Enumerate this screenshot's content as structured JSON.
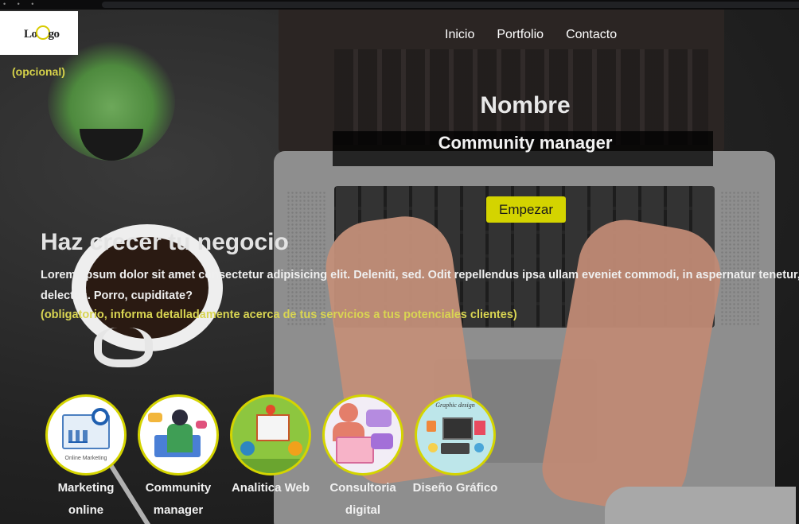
{
  "header": {
    "logo_text": "Lo",
    "logo_text_end": "go",
    "logo_note": "(opcional)",
    "nav": [
      "Inicio",
      "Portfolio",
      "Contacto"
    ]
  },
  "hero": {
    "name": "Nombre",
    "role": "Community manager",
    "cta_label": "Empezar"
  },
  "about": {
    "heading": "Haz crecer tu negocio",
    "body_line1": "Lorem, ipsum dolor sit amet consectetur adipisicing elit. Deleniti, sed. Odit repellendus ipsa ullam eveniet commodi, in aspernatur tenetur, hic es",
    "body_line2": "delectus. Porro, cupiditate?",
    "note": "(obligatorio, informa detalladamente acerca de tus servicios a tus potenciales clientes)"
  },
  "services": [
    {
      "label": "Marketing\nonline",
      "image_caption": "Online Marketing",
      "icon": "marketing-icon"
    },
    {
      "label": "Community\nmanager",
      "icon": "community-icon"
    },
    {
      "label": "Analitica Web",
      "icon": "analytics-icon"
    },
    {
      "label": "Consultoria\ndigital",
      "icon": "consulting-icon"
    },
    {
      "label": "Diseño Gráfico",
      "image_caption": "Graphic design",
      "icon": "design-icon"
    }
  ],
  "colors": {
    "accent": "#d4d400",
    "note_text": "#d9d552",
    "background": "#1e1e1f"
  }
}
